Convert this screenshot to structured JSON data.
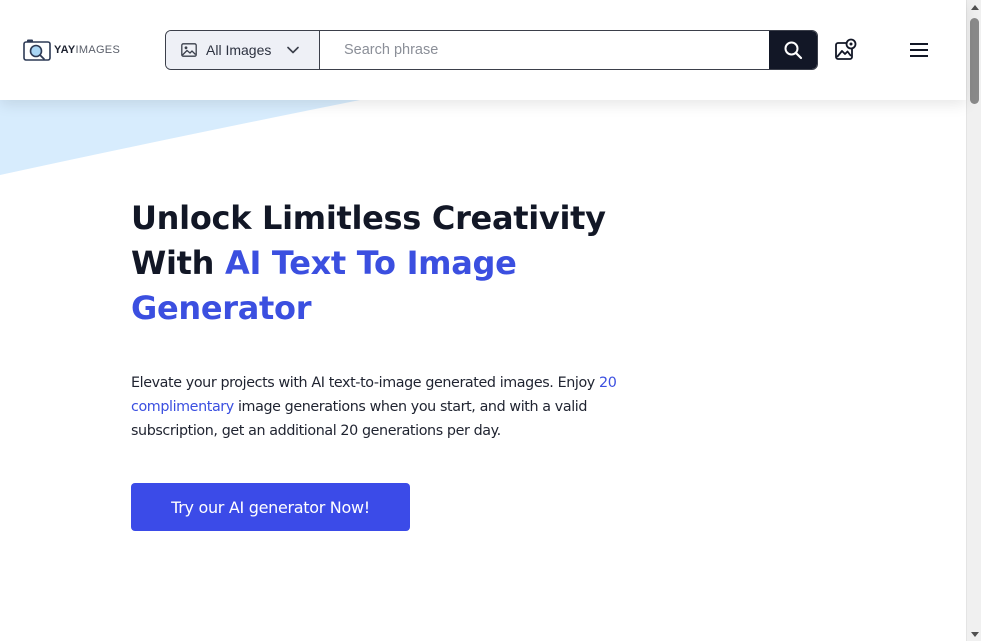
{
  "header": {
    "logo": {
      "prefix": "YAY",
      "suffix": "IMAGES"
    },
    "search": {
      "category_label": "All Images",
      "placeholder": "Search phrase",
      "value": ""
    }
  },
  "hero": {
    "title_part1": "Unlock Limitless Creativity With ",
    "title_highlight": "AI Text To Image Generator",
    "desc_part1": "Elevate your projects with AI text-to-image generated images. Enjoy ",
    "desc_link": "20 complimentary",
    "desc_part2": " image generations when you start, and with a valid subscription, get an additional 20 generations per day.",
    "cta_label": "Try our AI generator Now!"
  },
  "colors": {
    "accent": "#3b4be8",
    "highlight": "#3b4fe0",
    "dark": "#121726",
    "wedge": "#d7ecfd"
  },
  "icons": [
    "camera-search-icon",
    "image-icon",
    "chevron-down-icon",
    "search-icon",
    "gallery-settings-icon",
    "menu-icon"
  ]
}
